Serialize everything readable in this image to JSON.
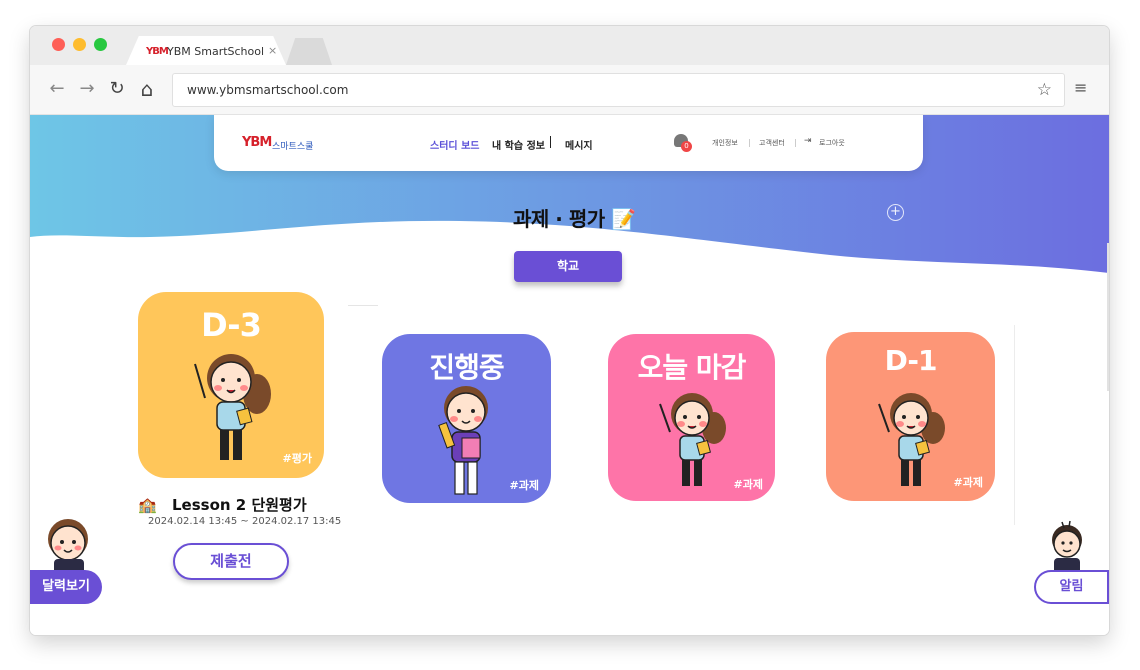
{
  "browser": {
    "tab_logo": "YBM",
    "tab_title": "YBM SmartSchool",
    "tab_close": "×",
    "url": "www.ybmsmartschool.com",
    "back": "←",
    "forward": "→",
    "reload": "↻",
    "home": "⌂",
    "star": "☆",
    "menu": "≡"
  },
  "header": {
    "logo": "YBM",
    "logo_sub": "스마트스쿨",
    "nav": [
      "스터디 보드",
      "내 학습 정보",
      "메시지"
    ],
    "active_nav_index": 0,
    "notification_count": "0",
    "util_links": [
      "개인정보",
      "고객센터",
      "로그아웃"
    ]
  },
  "page": {
    "title": "과제 · 평가 📝",
    "school_button": "학교"
  },
  "cards": [
    {
      "head": "D-3",
      "tag": "#평가",
      "color": "#ffc65a"
    },
    {
      "head": "진행중",
      "tag": "#과제",
      "color": "#6f76e3"
    },
    {
      "head": "오늘 마감",
      "tag": "#과제",
      "color": "#fe74a8"
    },
    {
      "head": "D-1",
      "tag": "#과제",
      "color": "#fd9677"
    }
  ],
  "featured": {
    "icon": "school-icon",
    "title": "Lesson 2 단원평가",
    "date_range": "2024.02.14 13:45 ~ 2024.02.17 13:45",
    "status_button": "제출전"
  },
  "side": {
    "calendar_button": "달력보기",
    "alarm_button": "알림"
  },
  "colors": {
    "accent": "#6a4fd5",
    "banner_start": "#6ec6e6",
    "banner_end": "#6c6ee0"
  }
}
